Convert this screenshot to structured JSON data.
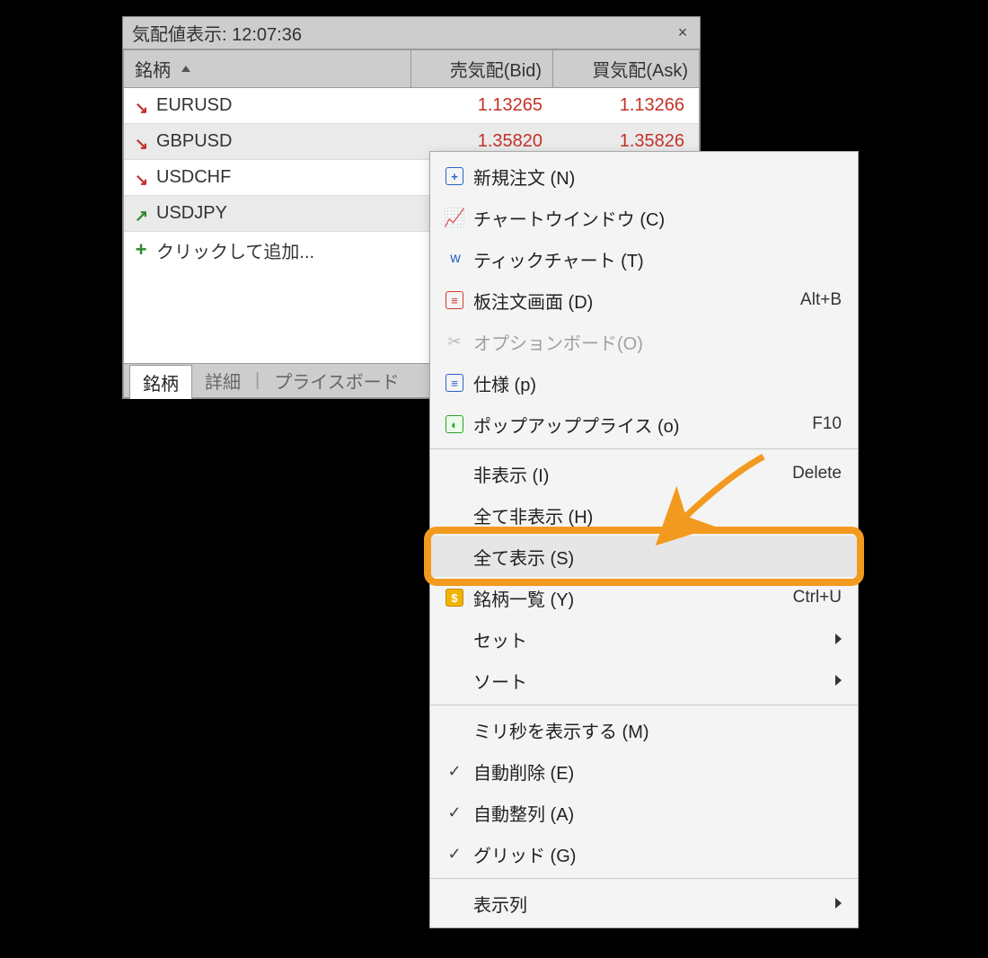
{
  "panel": {
    "title": "気配値表示: 12:07:36",
    "close_glyph": "×",
    "columns": {
      "symbol": "銘柄",
      "bid": "売気配(Bid)",
      "ask": "買気配(Ask)"
    },
    "rows": [
      {
        "dir": "down",
        "symbol": "EURUSD",
        "bid": "1.13265",
        "ask": "1.13266",
        "alt": false
      },
      {
        "dir": "down",
        "symbol": "GBPUSD",
        "bid": "1.35820",
        "ask": "1.35826",
        "alt": true
      },
      {
        "dir": "down",
        "symbol": "USDCHF",
        "bid": "",
        "ask": "",
        "alt": false
      },
      {
        "dir": "up",
        "symbol": "USDJPY",
        "bid": "",
        "ask": "",
        "alt": true
      }
    ],
    "add_row": "クリックして追加...",
    "tabs": {
      "t1": "銘柄",
      "t2": "詳細",
      "t3": "プライスボード",
      "sep": "|"
    }
  },
  "menu": {
    "items": [
      {
        "icon": "new-order-icon",
        "label": "新規注文 (N)",
        "accel": "",
        "kind": "item"
      },
      {
        "icon": "chart-icon",
        "label": "チャートウインドウ (C)",
        "accel": "",
        "kind": "item"
      },
      {
        "icon": "tick-chart-icon",
        "label": "ティックチャート (T)",
        "accel": "",
        "kind": "item"
      },
      {
        "icon": "dom-icon",
        "label": "板注文画面 (D)",
        "accel": "Alt+B",
        "kind": "item"
      },
      {
        "icon": "option-board-icon",
        "label": "オプションボード(O)",
        "accel": "",
        "kind": "disabled"
      },
      {
        "icon": "spec-icon",
        "label": "仕様 (p)",
        "accel": "",
        "kind": "item"
      },
      {
        "icon": "popup-price-icon",
        "label": "ポップアッププライス (o)",
        "accel": "F10",
        "kind": "item"
      },
      {
        "kind": "sep"
      },
      {
        "icon": "",
        "label": "非表示 (I)",
        "accel": "Delete",
        "kind": "item"
      },
      {
        "icon": "",
        "label": "全て非表示 (H)",
        "accel": "",
        "kind": "item"
      },
      {
        "icon": "",
        "label": "全て表示 (S)",
        "accel": "",
        "kind": "hover",
        "highlight": true
      },
      {
        "icon": "symbol-list-icon",
        "label": "銘柄一覧 (Y)",
        "accel": "Ctrl+U",
        "kind": "item"
      },
      {
        "icon": "",
        "label": "セット",
        "accel": "",
        "kind": "submenu"
      },
      {
        "icon": "",
        "label": "ソート",
        "accel": "",
        "kind": "submenu"
      },
      {
        "kind": "sep"
      },
      {
        "icon": "",
        "label": "ミリ秒を表示する (M)",
        "accel": "",
        "kind": "item"
      },
      {
        "icon": "check-icon",
        "label": "自動削除 (E)",
        "accel": "",
        "kind": "checked"
      },
      {
        "icon": "check-icon",
        "label": "自動整列 (A)",
        "accel": "",
        "kind": "checked"
      },
      {
        "icon": "check-icon",
        "label": "グリッド (G)",
        "accel": "",
        "kind": "checked"
      },
      {
        "kind": "sep"
      },
      {
        "icon": "",
        "label": "表示列",
        "accel": "",
        "kind": "submenu"
      }
    ]
  }
}
